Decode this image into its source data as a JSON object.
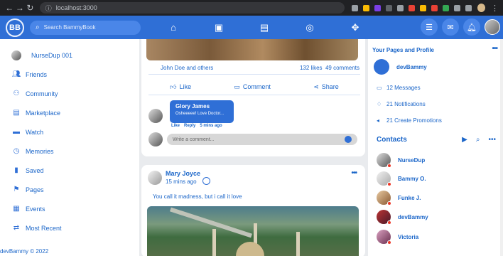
{
  "browser": {
    "url": "localhost:3000"
  },
  "header": {
    "logo": "BB",
    "search_placeholder": "Search BammyBook"
  },
  "user": {
    "name": "NurseDup 001"
  },
  "left_menu": [
    {
      "label": "Friends",
      "icon": "friends-icon"
    },
    {
      "label": "Community",
      "icon": "community-icon"
    },
    {
      "label": "Marketplace",
      "icon": "marketplace-icon"
    },
    {
      "label": "Watch",
      "icon": "watch-icon"
    },
    {
      "label": "Memories",
      "icon": "memories-icon"
    },
    {
      "label": "Saved",
      "icon": "bookmark-icon"
    },
    {
      "label": "Pages",
      "icon": "flag-icon"
    },
    {
      "label": "Events",
      "icon": "calendar-icon"
    },
    {
      "label": "Most Recent",
      "icon": "recent-icon"
    }
  ],
  "copyright": "devBammy © 2022",
  "post1": {
    "liked_by": "John Doe and others",
    "likes": "132 likes",
    "comments": "49 comments",
    "like_label": "Like",
    "comment_label": "Comment",
    "share_label": "Share",
    "comment": {
      "author": "Glory James",
      "text": "Osheeeee! Love Doctor...",
      "like": "Like",
      "reply": "Reply",
      "time": "5 mins ago"
    },
    "write_placeholder": "Write a comment..."
  },
  "post2": {
    "author": "Mary Joyce",
    "time": "15 mins ago",
    "caption": "You call it madness, but i call it love"
  },
  "right": {
    "title": "Your Pages and Profile",
    "page_name": "devBammy",
    "messages": "12 Messages",
    "notifications": "21 Notifications",
    "promotions": "21 Create Promotions",
    "contacts_title": "Contacts",
    "contacts": [
      {
        "name": "NurseDup"
      },
      {
        "name": "Bammy O."
      },
      {
        "name": "Funke J."
      },
      {
        "name": "devBammy"
      },
      {
        "name": "Victoria"
      }
    ]
  },
  "colors": {
    "brand": "#2f6fd6",
    "text_blue": "#1b66c9"
  }
}
